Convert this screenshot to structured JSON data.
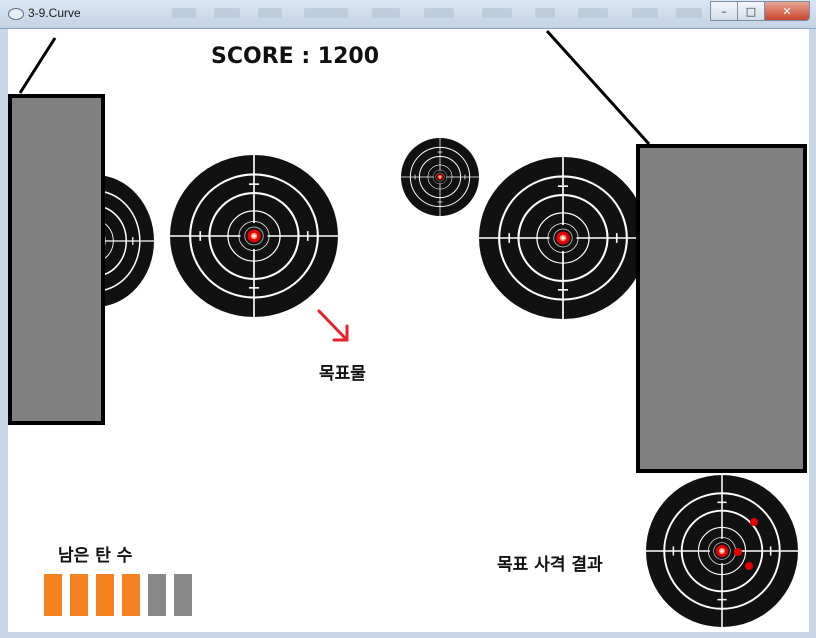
{
  "window": {
    "title": "3-9.Curve",
    "minimize_icon": "minimize-icon",
    "maximize_icon": "maximize-icon",
    "close_icon": "close-icon"
  },
  "game": {
    "score_text": "SCORE : 1200",
    "target_label": "목표물",
    "ammo_label": "남은 탄 수",
    "result_label": "목표 사격 결과",
    "ammo": {
      "total": 6,
      "remaining": 4,
      "remaining_color": "#f58220",
      "used_color": "#888888"
    },
    "colors": {
      "wall": "#808080",
      "target": "#111111",
      "bullseye": "#e60000",
      "arrow": "#e8202a"
    }
  }
}
